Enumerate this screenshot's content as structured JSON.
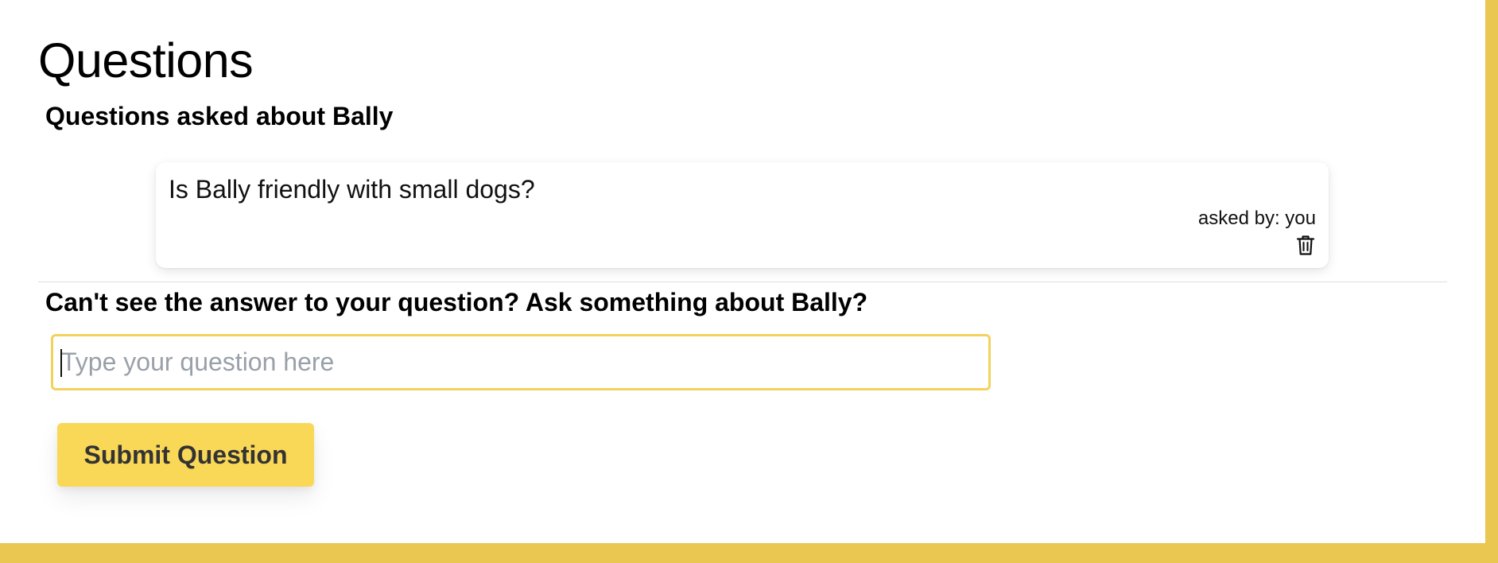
{
  "page": {
    "title": "Questions"
  },
  "asked_section": {
    "heading": "Questions asked about Bally",
    "questions": [
      {
        "text": "Is Bally friendly with small dogs?",
        "asked_by": "asked by: you",
        "delete_icon": "trash-icon"
      }
    ]
  },
  "ask_section": {
    "heading": "Can't see the answer to your question? Ask something about Bally?",
    "input_value": "",
    "input_placeholder": "Type your question here",
    "submit_label": "Submit Question"
  },
  "colors": {
    "accent": "#f9d757",
    "input_border": "#f3d25c",
    "page_frame": "#e9c751"
  }
}
